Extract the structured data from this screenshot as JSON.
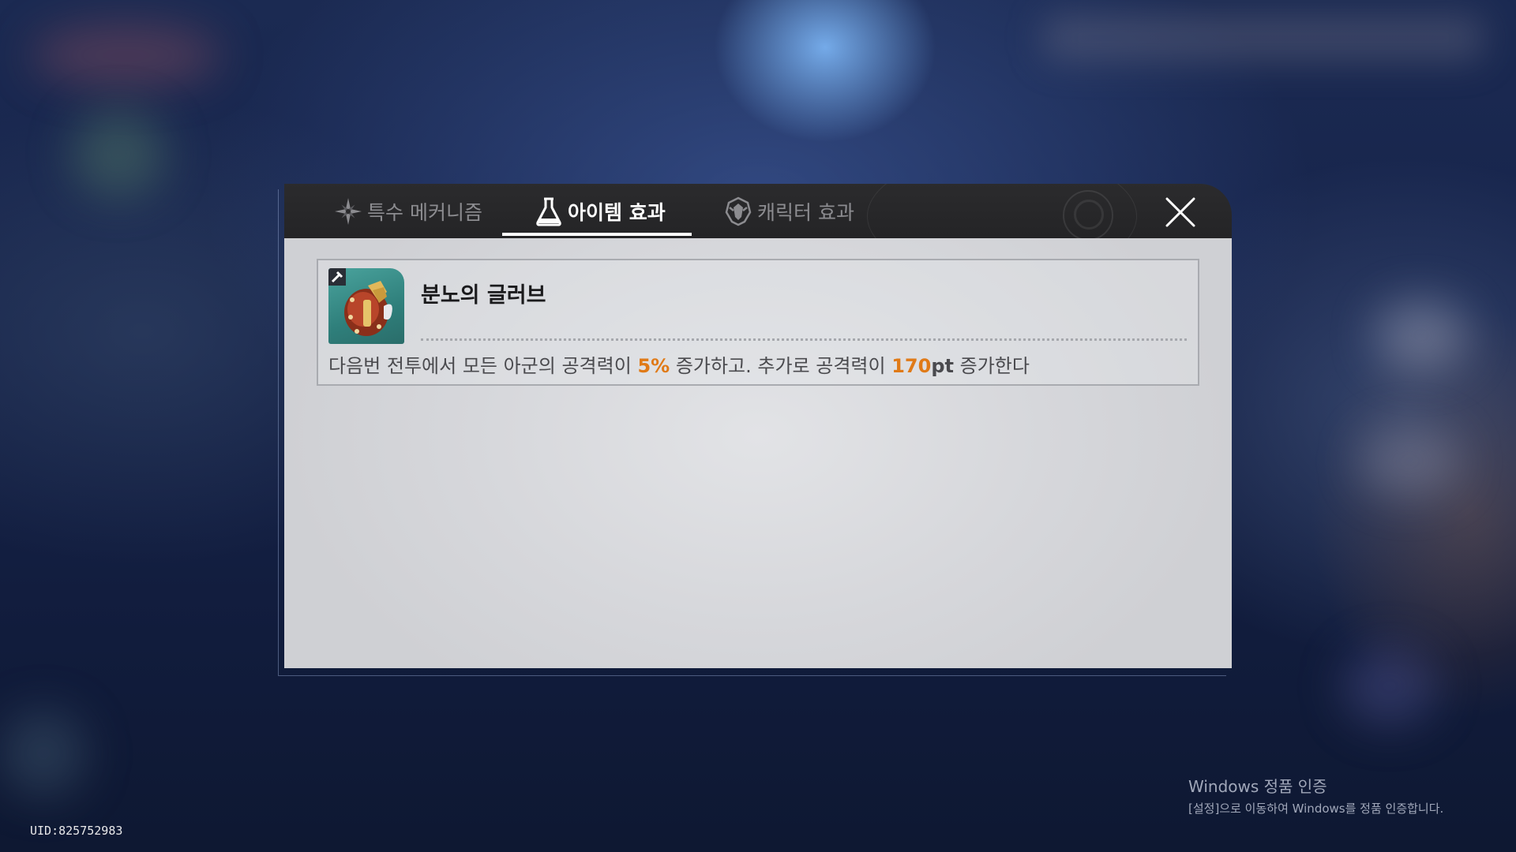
{
  "tabs": [
    {
      "label": "특수 메커니즘",
      "icon": "compass-star-icon",
      "active": false
    },
    {
      "label": "아이템 효과",
      "icon": "flask-icon",
      "active": true
    },
    {
      "label": "캐릭터 효과",
      "icon": "character-emblem-icon",
      "active": false
    }
  ],
  "close_icon": "close-x-icon",
  "item": {
    "name": "분노의 글러브",
    "icon": "glove-item-icon",
    "desc_part1": "다음번 전투에서 모든 아군의 공격력이 ",
    "desc_value1": "5%",
    "desc_part2": " 증가하고. 추가로 공격력이 ",
    "desc_value2": "170",
    "desc_value2_unit": "pt",
    "desc_part3": " 증가한다"
  },
  "watermark": {
    "title": "Windows 정품 인증",
    "subtitle": "[설정]으로 이동하여 Windows를 정품 인증합니다."
  },
  "uid": "UID:825752983",
  "colors": {
    "highlight": "#e07a17",
    "tabbar_bg": "#252527",
    "content_bg": "#d6d7db"
  }
}
